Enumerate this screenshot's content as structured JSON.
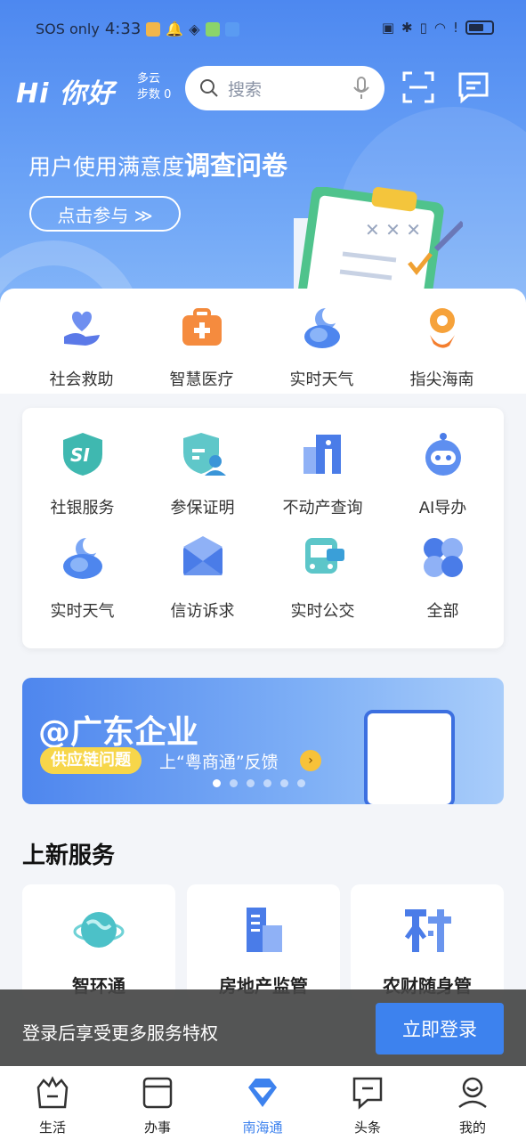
{
  "status_bar": {
    "carrier": "SOS only",
    "time": "4:33"
  },
  "header": {
    "greeting": "Hi 你好",
    "weather_condition": "多云",
    "steps": "步数 0",
    "search_placeholder": "搜索"
  },
  "banner": {
    "title_prefix": "用户使用满意度",
    "title_highlight": "调查问卷",
    "button": "点击参与 ≫"
  },
  "quick_services": [
    {
      "label": "社会救助",
      "icon": "heart-hand-icon"
    },
    {
      "label": "智慧医疗",
      "icon": "medical-kit-icon"
    },
    {
      "label": "实时天气",
      "icon": "weather-moon-icon"
    },
    {
      "label": "指尖海南",
      "icon": "fingertip-location-icon"
    }
  ],
  "grid_services": [
    {
      "label": "社银服务",
      "icon": "si-shield-icon"
    },
    {
      "label": "参保证明",
      "icon": "insurance-proof-icon"
    },
    {
      "label": "不动产查询",
      "icon": "property-building-icon"
    },
    {
      "label": "AI导办",
      "icon": "ai-robot-icon"
    },
    {
      "label": "实时天气",
      "icon": "weather-moon-icon"
    },
    {
      "label": "信访诉求",
      "icon": "envelope-icon"
    },
    {
      "label": "实时公交",
      "icon": "bus-icon"
    },
    {
      "label": "全部",
      "icon": "all-services-icon"
    }
  ],
  "promo": {
    "heading": "@广东企业",
    "tag": "供应链问题",
    "subtitle": "上“粤商通”反馈",
    "slide_count": 6,
    "active_slide": 1
  },
  "new_services": {
    "title": "上新服务",
    "items": [
      {
        "label": "智环通",
        "icon": "globe-icon"
      },
      {
        "label": "房地产监管",
        "icon": "buildings-icon"
      },
      {
        "label": "农财随身管",
        "icon": "village-icon"
      }
    ]
  },
  "login_prompt": {
    "text": "登录后享受更多服务特权",
    "button": "立即登录"
  },
  "tabs": [
    {
      "label": "生活",
      "icon": "life-basket-icon",
      "active": false
    },
    {
      "label": "办事",
      "icon": "window-icon",
      "active": false
    },
    {
      "label": "南海通",
      "icon": "diamond-icon",
      "active": true
    },
    {
      "label": "头条",
      "icon": "headline-chat-icon",
      "active": false
    },
    {
      "label": "我的",
      "icon": "profile-icon",
      "active": false
    }
  ],
  "colors": {
    "primary": "#3d82ee",
    "hero_top": "#4d88f0",
    "accent_yellow": "#f7d64a"
  }
}
